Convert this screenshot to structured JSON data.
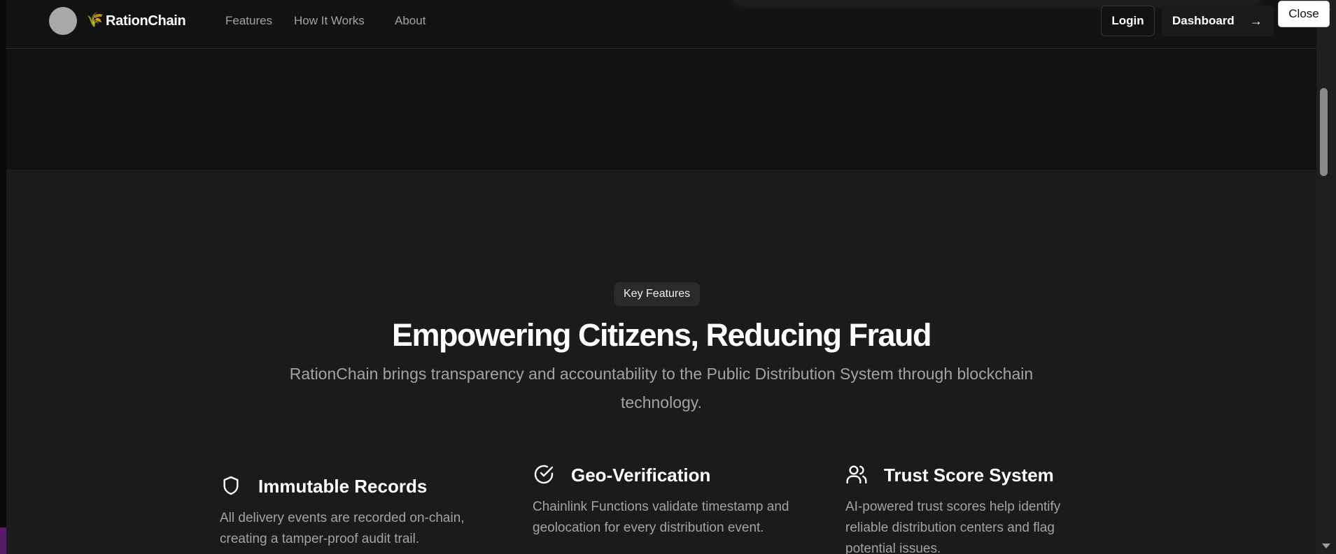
{
  "nav": {
    "brand_icon": "🌾",
    "brand": "RationChain",
    "links": [
      "Features",
      "How It Works",
      "About"
    ],
    "login": "Login",
    "dashboard": "Dashboard",
    "dashboard_arrow": "→"
  },
  "overlay": {
    "close": "Close"
  },
  "features": {
    "badge": "Key Features",
    "heading": "Empowering Citizens, Reducing Fraud",
    "subheading": "RationChain brings transparency and accountability to the Public Distribution System through blockchain technology.",
    "cards": [
      {
        "icon": "shield-icon",
        "title": "Immutable Records",
        "desc": "All delivery events are recorded on-chain, creating a tamper-proof audit trail."
      },
      {
        "icon": "circle-check-icon",
        "title": "Geo-Verification",
        "desc": "Chainlink Functions validate timestamp and geolocation for every distribution event."
      },
      {
        "icon": "users-icon",
        "title": "Trust Score System",
        "desc": "AI-powered trust scores help identify reliable distribution centers and flag potential issues."
      }
    ]
  },
  "colors": {
    "background": "#111111",
    "section": "#1b1b1b",
    "muted_text": "#a3a3a3",
    "accent": "#ffffff"
  }
}
